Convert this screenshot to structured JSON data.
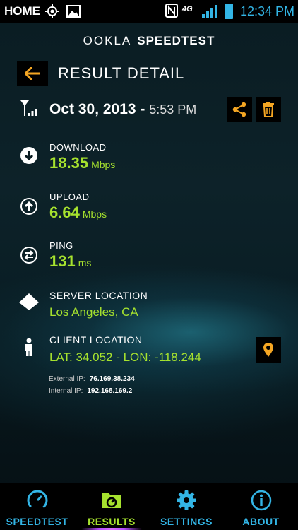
{
  "status_bar": {
    "home": "HOME",
    "network": "4G",
    "time": "12:34 PM"
  },
  "brand": {
    "part1": "OOKLA",
    "part2": "SPEEDTEST"
  },
  "header": {
    "title": "RESULT DETAIL"
  },
  "result": {
    "date": "Oct 30, 2013",
    "separator": " - ",
    "time": "5:53 PM"
  },
  "download": {
    "label": "DOWNLOAD",
    "value": "18.35",
    "unit": "Mbps"
  },
  "upload": {
    "label": "UPLOAD",
    "value": "6.64",
    "unit": "Mbps"
  },
  "ping": {
    "label": "PING",
    "value": "131",
    "unit": "ms"
  },
  "server": {
    "label": "SERVER LOCATION",
    "value": "Los Angeles, CA"
  },
  "client": {
    "label": "CLIENT LOCATION",
    "value": "LAT: 34.052 - LON: -118.244",
    "external_ip_label": "External IP:",
    "external_ip": "76.169.38.234",
    "internal_ip_label": "Internal IP:",
    "internal_ip": "192.168.169.2"
  },
  "nav": {
    "items": [
      {
        "label": "SPEEDTEST",
        "color": "#33b5e5"
      },
      {
        "label": "RESULTS",
        "color": "#a6e22e"
      },
      {
        "label": "SETTINGS",
        "color": "#33b5e5"
      },
      {
        "label": "ABOUT",
        "color": "#33b5e5"
      }
    ],
    "active": "RESULTS"
  },
  "colors": {
    "accent_orange": "#f5a623",
    "value_green": "#a6e22e",
    "nav_blue": "#33b5e5",
    "active_underline": "#b44dff"
  }
}
